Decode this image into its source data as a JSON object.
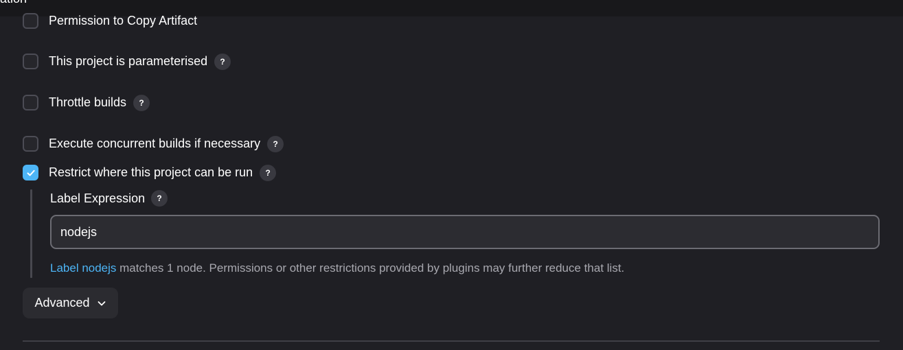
{
  "topbar": {
    "partial_text": "ation"
  },
  "options": [
    {
      "label": "Permission to Copy Artifact",
      "checked": false,
      "has_help": false
    },
    {
      "label": "This project is parameterised",
      "checked": false,
      "has_help": true
    },
    {
      "label": "Throttle builds",
      "checked": false,
      "has_help": true
    },
    {
      "label": "Execute concurrent builds if necessary",
      "checked": false,
      "has_help": true
    },
    {
      "label": "Restrict where this project can be run",
      "checked": true,
      "has_help": true
    }
  ],
  "help_glyph": "?",
  "label_expression": {
    "label": "Label Expression",
    "value": "nodejs",
    "validation": {
      "link_text": "Label nodejs",
      "message": " matches 1 node. Permissions or other restrictions provided by plugins may further reduce that list."
    }
  },
  "advanced_button": {
    "label": "Advanced",
    "icon": "chevron-down-icon"
  },
  "colors": {
    "background": "#1f1f24",
    "accent": "#4db5f6",
    "checkbox_border": "#4c4c55"
  }
}
